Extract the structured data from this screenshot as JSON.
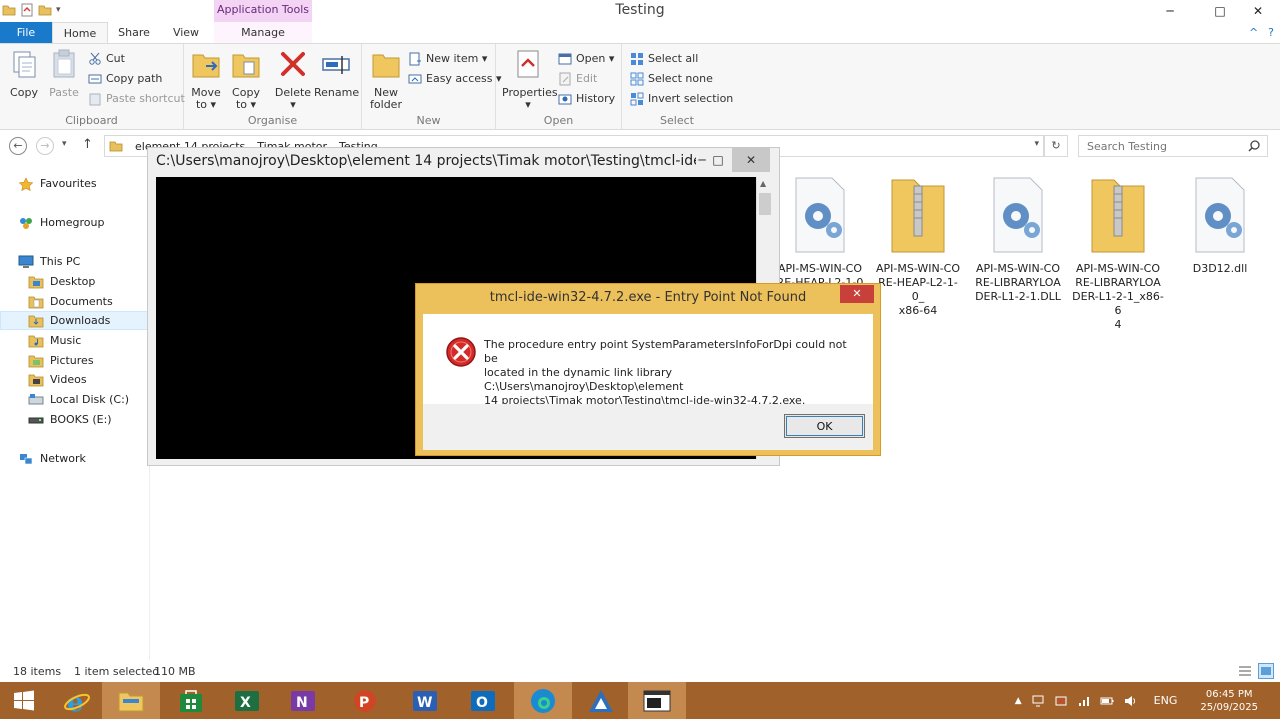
{
  "window": {
    "title": "Testing",
    "app_tools": "Application Tools",
    "min": "─",
    "max": "□",
    "close": "✕"
  },
  "tabs": {
    "file": "File",
    "home": "Home",
    "share": "Share",
    "view": "View",
    "manage": "Manage",
    "collapse": "^",
    "help": "?"
  },
  "ribbon": {
    "clipboard": {
      "label": "Clipboard",
      "copy": "Copy",
      "paste": "Paste",
      "cut": "Cut",
      "copy_path": "Copy path",
      "paste_shortcut": "Paste shortcut"
    },
    "organise": {
      "label": "Organise",
      "move_to": "Move",
      "move_to2": "to ▾",
      "copy_to": "Copy",
      "copy_to2": "to ▾",
      "delete": "Delete",
      "delete2": "▾",
      "rename": "Rename"
    },
    "new": {
      "label": "New",
      "new_folder": "New",
      "new_folder2": "folder",
      "new_item": "New item ▾",
      "easy_access": "Easy access ▾"
    },
    "open": {
      "label": "Open",
      "properties": "Properties",
      "properties2": "▾",
      "open": "Open ▾",
      "edit": "Edit",
      "history": "History"
    },
    "select": {
      "label": "Select",
      "select_all": "Select all",
      "select_none": "Select none",
      "invert": "Invert selection"
    }
  },
  "address": {
    "back": "←",
    "forward": "→",
    "recent": "▾",
    "up": "↑",
    "crumbs": [
      "element 14 projects",
      "Timak motor",
      "Testing"
    ],
    "dropdown": "▾",
    "refresh": "↻",
    "search_placeholder": "Search Testing"
  },
  "nav": {
    "favourites": "Favourites",
    "homegroup": "Homegroup",
    "this_pc": "This PC",
    "desktop": "Desktop",
    "documents": "Documents",
    "downloads": "Downloads",
    "music": "Music",
    "pictures": "Pictures",
    "videos": "Videos",
    "local_disk": "Local Disk (C:)",
    "books": "BOOKS (E:)",
    "network": "Network"
  },
  "files": [
    {
      "name1": "API-MS-WIN-CO",
      "name2": "RE-HEAP-L2-1-0",
      "name3": ""
    },
    {
      "name1": "API-MS-WIN-CO",
      "name2": "RE-HEAP-L2-1-0_",
      "name3": "x86-64"
    },
    {
      "name1": "API-MS-WIN-CO",
      "name2": "RE-LIBRARYLOA",
      "name3": "DER-L1-2-1.DLL"
    },
    {
      "name1": "API-MS-WIN-CO",
      "name2": "RE-LIBRARYLOA",
      "name3": "DER-L1-2-1_x86-6",
      "name4": "4"
    },
    {
      "name1": "D3D12.dll",
      "name2": "",
      "name3": ""
    }
  ],
  "status": {
    "items": "18 items",
    "selected": "1 item selected",
    "size": "110 MB"
  },
  "console": {
    "title": "C:\\Users\\manojroy\\Desktop\\element 14 projects\\Timak motor\\Testing\\tmcl-ide...",
    "min": "─",
    "max": "□",
    "close": "✕"
  },
  "dialog": {
    "title": "tmcl-ide-win32-4.7.2.exe - Entry Point Not Found",
    "close": "✕",
    "line1": "The procedure entry point SystemParametersInfoForDpi could not be",
    "line2": "located in the dynamic link library C:\\Users\\manojroy\\Desktop\\element",
    "line3": "14 projects\\Timak motor\\Testing\\tmcl-ide-win32-4.7.2.exe.",
    "ok": "OK"
  },
  "tray": {
    "lang": "ENG",
    "time": "06:45 PM",
    "date": "25/09/2025",
    "show_hidden": "▲"
  }
}
